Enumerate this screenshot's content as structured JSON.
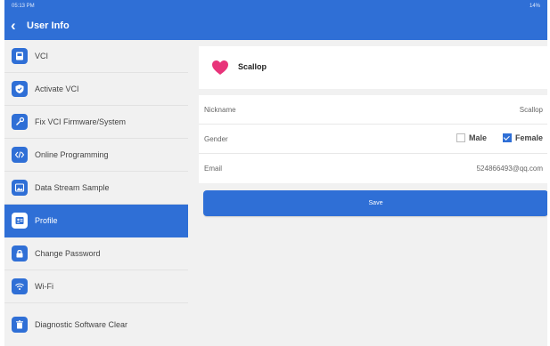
{
  "statusbar": {
    "time": "05:13 PM",
    "battery": "14%"
  },
  "header": {
    "title": "User Info"
  },
  "sidebar": {
    "items": [
      {
        "label": "VCI",
        "icon": "vci-icon"
      },
      {
        "label": "Activate VCI",
        "icon": "shield-check-icon"
      },
      {
        "label": "Fix VCI Firmware/System",
        "icon": "fix-icon"
      },
      {
        "label": "Online Programming",
        "icon": "code-icon"
      },
      {
        "label": "Data Stream Sample",
        "icon": "image-icon"
      },
      {
        "label": "Profile",
        "icon": "profile-icon",
        "active": true
      },
      {
        "label": "Change Password",
        "icon": "lock-icon"
      },
      {
        "label": "Wi-Fi",
        "icon": "wifi-icon"
      },
      {
        "label": "Diagnostic Software Clear",
        "icon": "trash-icon"
      }
    ]
  },
  "profile": {
    "name": "Scallop",
    "avatar_color": "#e8347a"
  },
  "form": {
    "nickname": {
      "label": "Nickname",
      "value": "Scallop"
    },
    "gender": {
      "label": "Gender",
      "options": [
        {
          "label": "Male",
          "checked": false
        },
        {
          "label": "Female",
          "checked": true
        }
      ]
    },
    "email": {
      "label": "Email",
      "value": "524866493@qq.com"
    }
  },
  "save_label": "Save",
  "colors": {
    "accent": "#2f6fd6",
    "background": "#f1f1f1"
  }
}
